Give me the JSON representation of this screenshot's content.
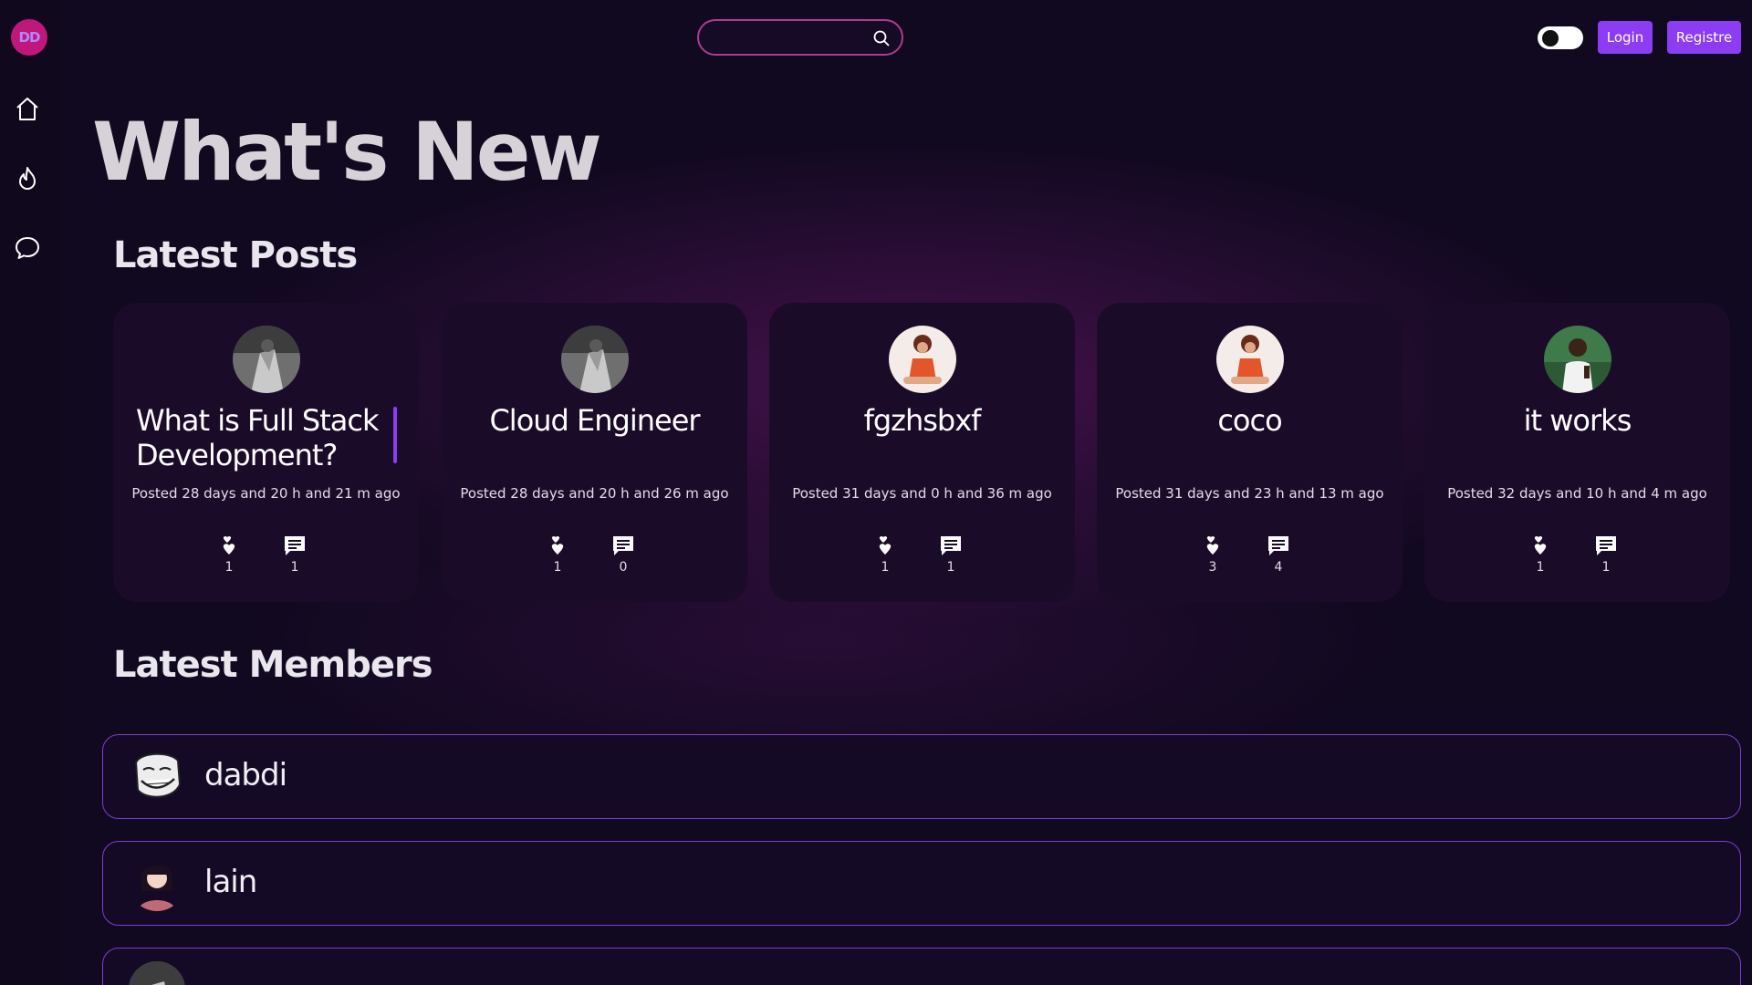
{
  "app": {
    "logo_text": "DD",
    "theme_toggle": "dark"
  },
  "sidebar": {
    "items": [
      {
        "name": "home",
        "icon": "home-icon"
      },
      {
        "name": "trending",
        "icon": "flame-icon"
      },
      {
        "name": "messages",
        "icon": "chat-bubble-icon"
      }
    ]
  },
  "header": {
    "search": {
      "value": "",
      "placeholder": ""
    },
    "login_label": "Login",
    "register_label": "Registre"
  },
  "main": {
    "page_title": "What's New",
    "latest_posts_title": "Latest Posts",
    "latest_members_title": "Latest Members",
    "posts": [
      {
        "title": "What is Full Stack Development?",
        "posted": "Posted 28 days and 20 h and 21 m ago",
        "likes": "1",
        "comments": "1",
        "avatar": "gray-photo-avatar"
      },
      {
        "title": "Cloud Engineer",
        "posted": "Posted 28 days and 20 h and 26 m ago",
        "likes": "1",
        "comments": "0",
        "avatar": "gray-photo-avatar"
      },
      {
        "title": "fgzhsbxf",
        "posted": "Posted 31 days and 0 h and 36 m ago",
        "likes": "1",
        "comments": "1",
        "avatar": "orange-figure-avatar"
      },
      {
        "title": "coco",
        "posted": "Posted 31 days and 23 h and 13 m ago",
        "likes": "3",
        "comments": "4",
        "avatar": "orange-figure-avatar"
      },
      {
        "title": "it works",
        "posted": "Posted 32 days and 10 h and 4 m ago",
        "likes": "1",
        "comments": "1",
        "avatar": "green-person-avatar"
      }
    ],
    "members": [
      {
        "name": "dabdi",
        "avatar": "troll-face-avatar"
      },
      {
        "name": "lain",
        "avatar": "anime-girl-avatar"
      },
      {
        "name": "",
        "avatar": "gray-photo-avatar"
      }
    ]
  },
  "colors": {
    "background": "#110920",
    "accent": "#8b3cf4",
    "search_border": "#b03a8e",
    "card_bg": "#1a0b28",
    "member_border": "#7d3ed6"
  }
}
